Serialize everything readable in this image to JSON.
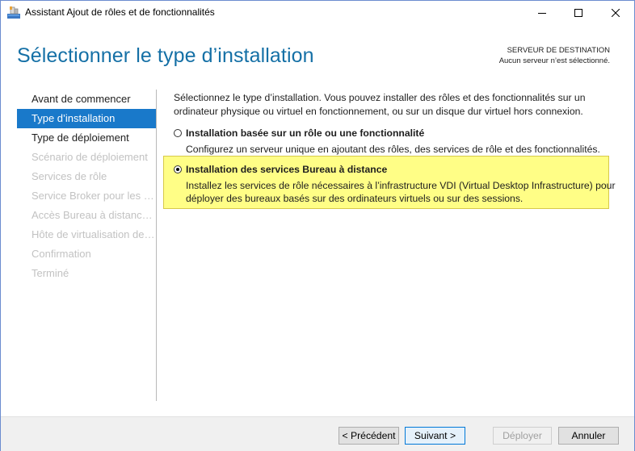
{
  "window": {
    "title": "Assistant Ajout de rôles et de fonctionnalités",
    "icon": "server-manager-icon"
  },
  "header": {
    "title": "Sélectionner le type d’installation",
    "destination_label": "SERVEUR DE DESTINATION",
    "destination_value": "Aucun serveur n’est sélectionné."
  },
  "nav": {
    "items": [
      {
        "label": "Avant de commencer",
        "state": "done"
      },
      {
        "label": "Type d’installation",
        "state": "active"
      },
      {
        "label": "Type de déploiement",
        "state": "done"
      },
      {
        "label": "Scénario de déploiement",
        "state": "disabled"
      },
      {
        "label": "Services de rôle",
        "state": "disabled"
      },
      {
        "label": "Service Broker pour les c...",
        "state": "disabled"
      },
      {
        "label": "Accès Bureau à distance...",
        "state": "disabled"
      },
      {
        "label": "Hôte de virtualisation des...",
        "state": "disabled"
      },
      {
        "label": "Confirmation",
        "state": "disabled"
      },
      {
        "label": "Terminé",
        "state": "disabled"
      }
    ]
  },
  "content": {
    "intro": "Sélectionnez le type d’installation. Vous pouvez installer des rôles et des fonctionnalités sur un ordinateur physique ou virtuel en fonctionnement, ou sur un disque dur virtuel hors connexion.",
    "options": [
      {
        "title": "Installation basée sur un rôle ou une fonctionnalité",
        "description": "Configurez un serveur unique en ajoutant des rôles, des services de rôle et des fonctionnalités.",
        "selected": false
      },
      {
        "title": "Installation des services Bureau à distance",
        "description": "Installez les services de rôle nécessaires à l’infrastructure VDI (Virtual Desktop Infrastructure) pour déployer des bureaux basés sur des ordinateurs virtuels ou sur des sessions.",
        "selected": true
      }
    ],
    "highlight_color": "#fffe86"
  },
  "footer": {
    "previous": "< Précédent",
    "next": "Suivant >",
    "deploy": "Déployer",
    "cancel": "Annuler"
  },
  "colors": {
    "accent": "#1979ca",
    "title": "#1570a6"
  }
}
